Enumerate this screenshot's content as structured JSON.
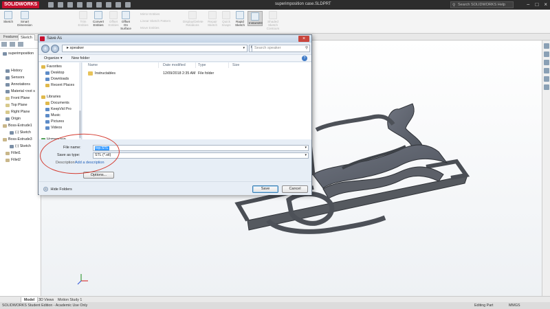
{
  "app": {
    "logo": "SOLIDWORKS",
    "doc_title": "superimposition case.SLDPRT",
    "help_search_placeholder": "Search SOLIDWORKS Help",
    "window_controls": [
      "−",
      "□",
      "×"
    ]
  },
  "command_manager": {
    "buttons": [
      {
        "label": "Sketch",
        "enabled": true
      },
      {
        "label": "Smart Dimension",
        "enabled": true
      },
      {
        "label": "Trim Entities",
        "enabled": false
      },
      {
        "label": "Convert Entities",
        "enabled": true
      },
      {
        "label": "Offset Entities",
        "enabled": false
      },
      {
        "label": "Offset On Surface",
        "enabled": true
      },
      {
        "label": "Mirror Entities",
        "enabled": false
      },
      {
        "label": "Linear Sketch Pattern",
        "enabled": false
      },
      {
        "label": "Move Entities",
        "enabled": false
      },
      {
        "label": "Display/Delete Relations",
        "enabled": false
      },
      {
        "label": "Repair Sketch",
        "enabled": false
      },
      {
        "label": "Quick Snaps",
        "enabled": false
      },
      {
        "label": "Rapid Sketch",
        "enabled": true
      },
      {
        "label": "Instant2D",
        "enabled": true,
        "active": true
      },
      {
        "label": "Shaded Sketch Contours",
        "enabled": false
      }
    ],
    "tabs": [
      "Features",
      "Sketch"
    ],
    "active_tab": "Sketch"
  },
  "feature_tree": {
    "items": [
      {
        "label": "superimposition",
        "icon": "part-icon"
      },
      {
        "label": "History",
        "icon": "history-icon"
      },
      {
        "label": "Sensors",
        "icon": "sensor-icon"
      },
      {
        "label": "Annotations",
        "icon": "annotation-icon"
      },
      {
        "label": "Material <not s",
        "icon": "material-icon"
      },
      {
        "label": "Front Plane",
        "icon": "plane-icon"
      },
      {
        "label": "Top Plane",
        "icon": "plane-icon"
      },
      {
        "label": "Right Plane",
        "icon": "plane-icon"
      },
      {
        "label": "Origin",
        "icon": "origin-icon"
      },
      {
        "label": "Boss-Extrude1",
        "icon": "extrude-icon"
      },
      {
        "label": "(-) Sketch",
        "icon": "sketch-icon"
      },
      {
        "label": "Boss-Extrude3",
        "icon": "extrude-icon"
      },
      {
        "label": "(-) Sketch",
        "icon": "sketch-icon"
      },
      {
        "label": "Fillet1",
        "icon": "fillet-icon"
      },
      {
        "label": "Fillet2",
        "icon": "fillet-icon"
      }
    ]
  },
  "dialog": {
    "title": "Save As",
    "breadcrumb": "▸ speaker",
    "search_placeholder": "Search speaker",
    "toolbar": {
      "organize": "Organize ▾",
      "new_folder": "New folder"
    },
    "nav_pane": [
      {
        "label": "Favorites",
        "icon": "star-icon",
        "group": true
      },
      {
        "label": "Desktop",
        "icon": "desktop-icon"
      },
      {
        "label": "Downloads",
        "icon": "downloads-icon"
      },
      {
        "label": "Recent Places",
        "icon": "recent-places-icon"
      },
      {
        "label": "Libraries",
        "icon": "libraries-icon",
        "group": true
      },
      {
        "label": "Documents",
        "icon": "documents-icon"
      },
      {
        "label": "KeepVid Pro",
        "icon": "keepvid-icon"
      },
      {
        "label": "Music",
        "icon": "music-icon"
      },
      {
        "label": "Pictures",
        "icon": "pictures-icon"
      },
      {
        "label": "Videos",
        "icon": "videos-icon"
      },
      {
        "label": "Homegroup",
        "icon": "homegroup-icon",
        "group": true
      }
    ],
    "columns": [
      "Name",
      "Date modified",
      "Type",
      "Size"
    ],
    "files": [
      {
        "name": "Instructables",
        "date_modified": "12/09/2018 2:35 AM",
        "type": "File folder",
        "size": ""
      }
    ],
    "file_name_label": "File name:",
    "file_name_value": "top.STL",
    "save_as_type_label": "Save as type:",
    "save_as_type_value": "STL (*.stl)",
    "description_label": "Description:",
    "description_link": "Add a description",
    "options_button": "Options...",
    "hide_folders": "Hide Folders",
    "save_button": "Save",
    "cancel_button": "Cancel"
  },
  "bottom_tabs": [
    "Model",
    "3D Views",
    "Motion Study 1"
  ],
  "active_bottom_tab": "Model",
  "status_bar": {
    "edition": "SOLIDWORKS Student Edition - Academic Use Only",
    "mode": "Editing Part",
    "units": "MMGS"
  }
}
